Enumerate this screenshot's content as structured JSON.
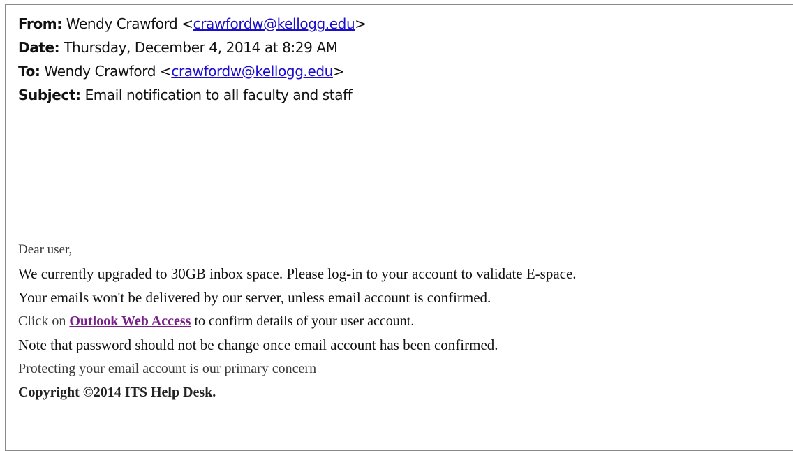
{
  "header": {
    "from_label": "From:",
    "from_name": "Wendy Crawford <",
    "from_email": "crawfordw@kellogg.edu",
    "from_close": ">",
    "date_label": "Date:",
    "date_value": "Thursday, December 4, 2014 at 8:29 AM",
    "to_label": "To:",
    "to_name": "Wendy Crawford <",
    "to_email": "crawfordw@kellogg.edu",
    "to_close": ">",
    "subject_label": "Subject:",
    "subject_value": "Email notification to all faculty and staff"
  },
  "body": {
    "greeting": "Dear user,",
    "line1": "We currently upgraded to 30GB inbox space. Please log-in to your account to validate E-space.",
    "line2": "Your emails won't be delivered by our server, unless email account is confirmed.",
    "line3_prefix": "Click on ",
    "line3_link": "Outlook Web Access",
    "line3_suffix": " to confirm details of your user account.",
    "line4": "Note that password should not be change once email account has been confirmed.",
    "line5": "Protecting your email account is our primary concern",
    "copyright": "Copyright ©2014 ITS Help Desk."
  },
  "colors": {
    "link": "#1a0dcc",
    "visited_link": "#7a1f8a",
    "border": "#8a8a8a"
  }
}
